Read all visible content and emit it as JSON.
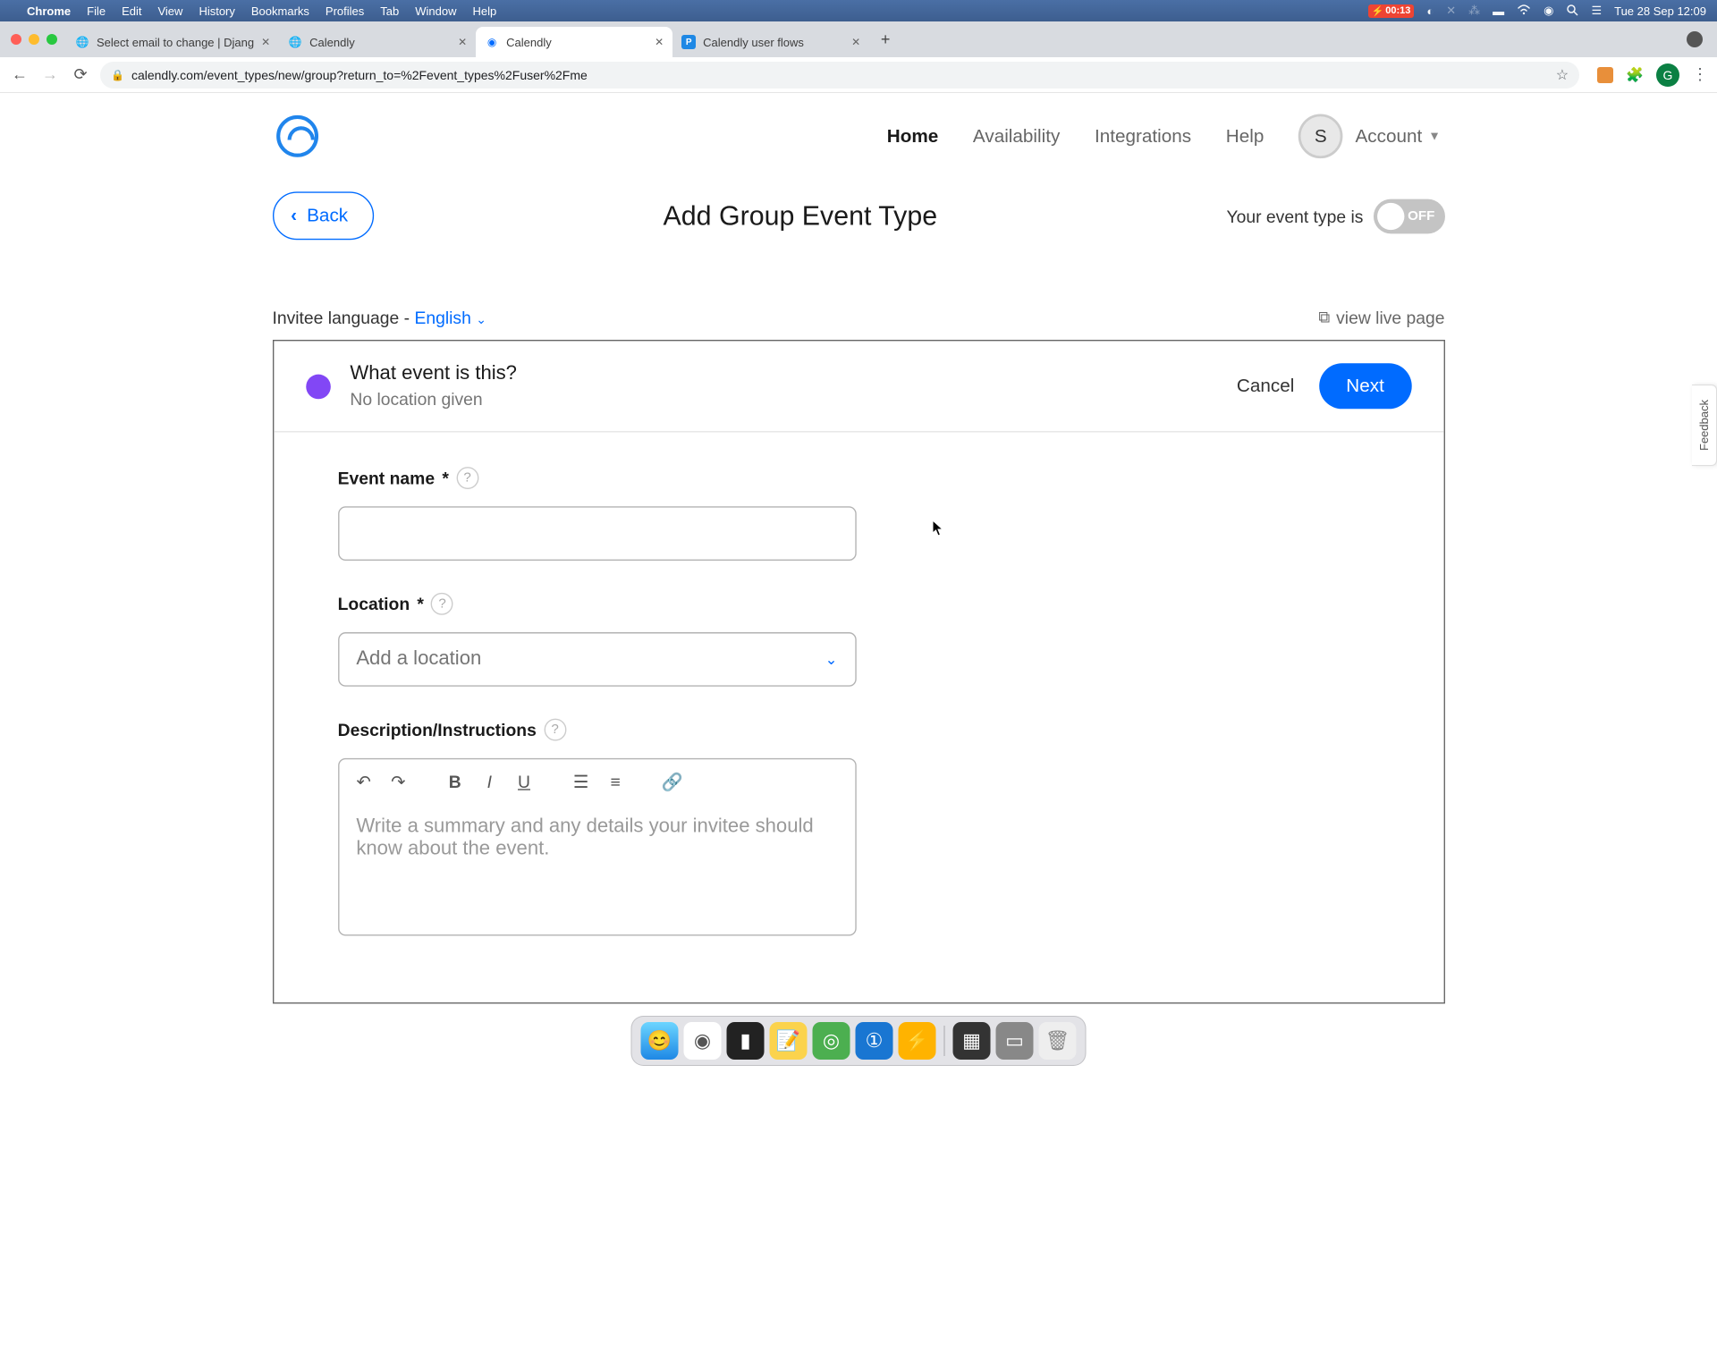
{
  "menubar": {
    "app": "Chrome",
    "items": [
      "File",
      "Edit",
      "View",
      "History",
      "Bookmarks",
      "Profiles",
      "Tab",
      "Window",
      "Help"
    ],
    "battery": "00:13",
    "clock": "Tue 28 Sep  12:09"
  },
  "tabs": [
    {
      "title": "Select email to change | Djang",
      "favicon": "globe"
    },
    {
      "title": "Calendly",
      "favicon": "globe"
    },
    {
      "title": "Calendly",
      "favicon": "calendly",
      "active": true
    },
    {
      "title": "Calendly user flows",
      "favicon": "p"
    }
  ],
  "url": "calendly.com/event_types/new/group?return_to=%2Fevent_types%2Fuser%2Fme",
  "avatar_letter": "G",
  "nav": {
    "items": [
      "Home",
      "Availability",
      "Integrations",
      "Help"
    ],
    "active": "Home",
    "account_letter": "S",
    "account_label": "Account"
  },
  "page": {
    "back": "Back",
    "title": "Add Group Event Type",
    "toggle_label": "Your event type is",
    "toggle_state": "OFF"
  },
  "subrow": {
    "invitee_prefix": "Invitee language - ",
    "invitee_lang": "English",
    "view_live": "view live page"
  },
  "card": {
    "header_title": "What event is this?",
    "header_sub": "No location given",
    "cancel": "Cancel",
    "next": "Next"
  },
  "form": {
    "event_name_label": "Event name",
    "location_label": "Location",
    "location_placeholder": "Add a location",
    "desc_label": "Description/Instructions",
    "desc_placeholder": "Write a summary and any details your invitee should know about the event."
  },
  "feedback": "Feedback"
}
